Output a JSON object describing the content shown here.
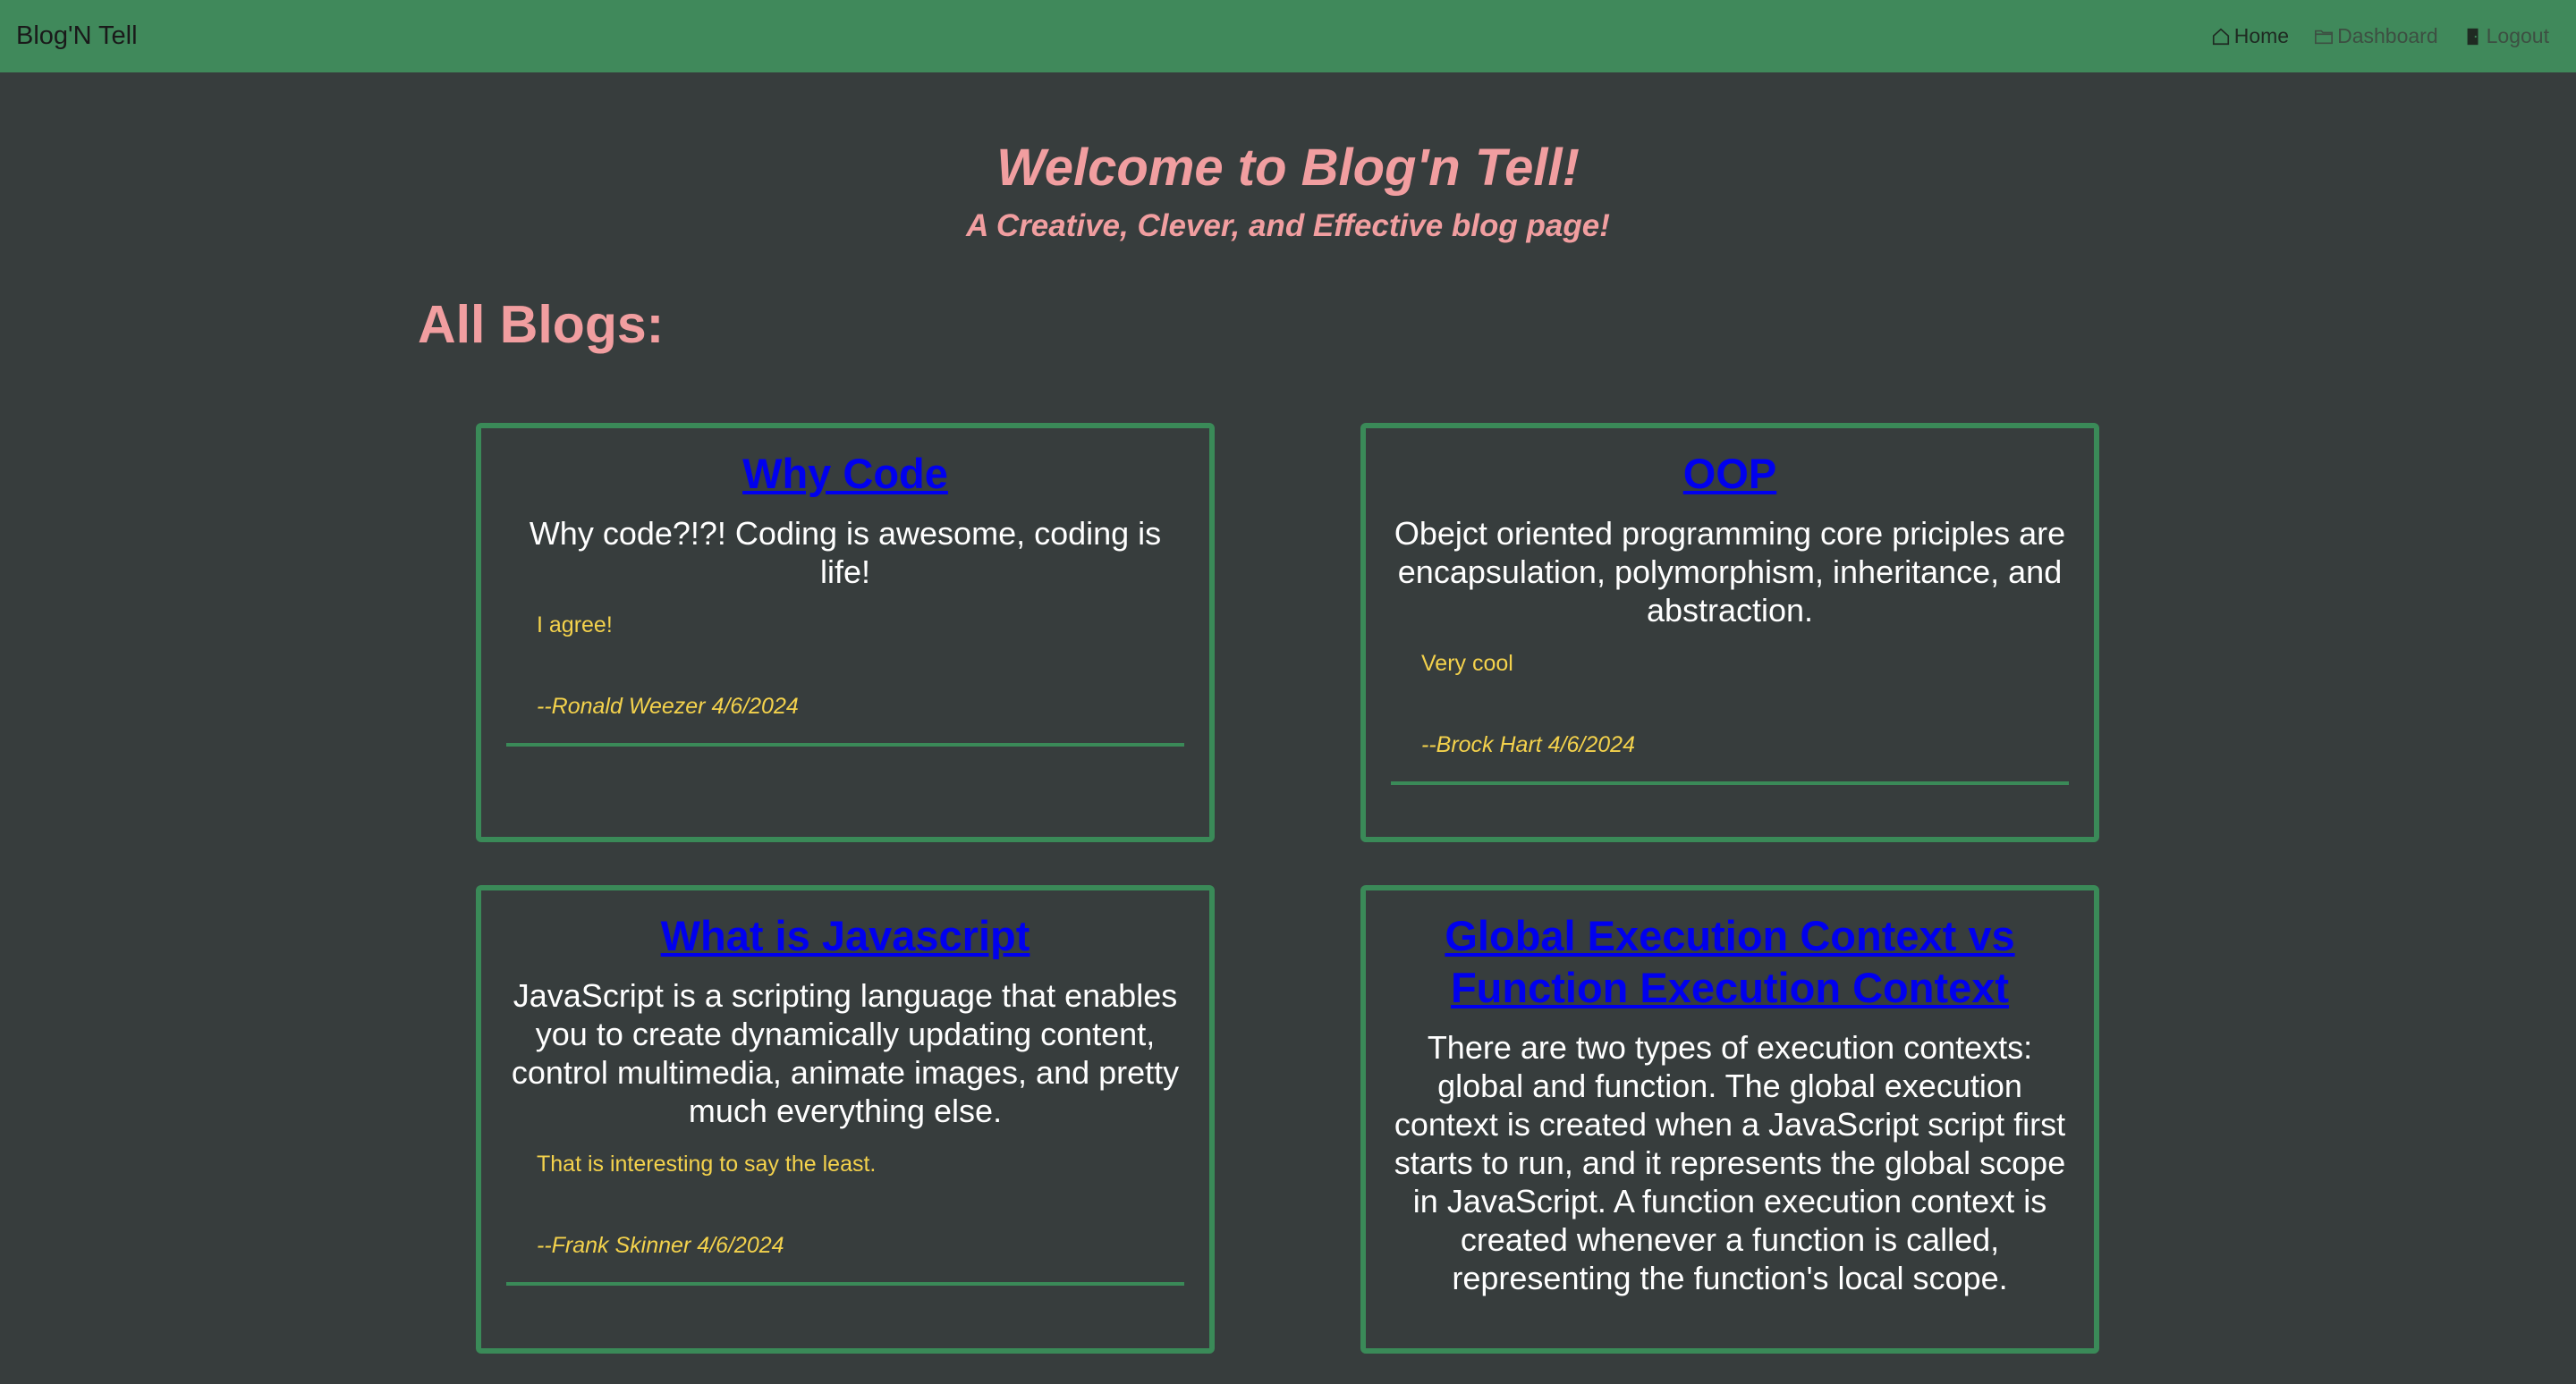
{
  "navbar": {
    "brand": "Blog'N Tell",
    "links": [
      {
        "label": "Home",
        "icon": "home-icon"
      },
      {
        "label": "Dashboard",
        "icon": "folder-icon"
      },
      {
        "label": "Logout",
        "icon": "door-icon"
      }
    ]
  },
  "hero": {
    "title": "Welcome to Blog'n Tell!",
    "subtitle": "A Creative, Clever, and Effective blog page!"
  },
  "section_title": "All Blogs:",
  "posts": [
    {
      "title": "Why Code",
      "body": "Why code?!?! Coding is awesome, coding is life!",
      "comment": "I agree!",
      "comment_author": "--Ronald Weezer 4/6/2024"
    },
    {
      "title": "OOP",
      "body": "Obejct oriented programming core priciples are encapsulation, polymorphism, inheritance, and abstraction.",
      "comment": "Very cool",
      "comment_author": "--Brock Hart 4/6/2024"
    },
    {
      "title": "What is Javascript",
      "body": "JavaScript is a scripting language that enables you to create dynamically updating content, control multimedia, animate images, and pretty much everything else.",
      "comment": "That is interesting to say the least.",
      "comment_author": "--Frank Skinner 4/6/2024"
    },
    {
      "title": "Global Execution Context vs Function Execution Context",
      "body": "There are two types of execution contexts: global and function. The global execution context is created when a JavaScript script first starts to run, and it represents the global scope in JavaScript. A function execution context is created whenever a function is called, representing the function's local scope."
    }
  ],
  "colors": {
    "navbar": "#40895b",
    "background": "#373d3d",
    "accent_pink": "#f19ea0",
    "comment_yellow": "#f4d24c",
    "link_blue": "#0000ee",
    "card_border": "#3a8a58"
  }
}
